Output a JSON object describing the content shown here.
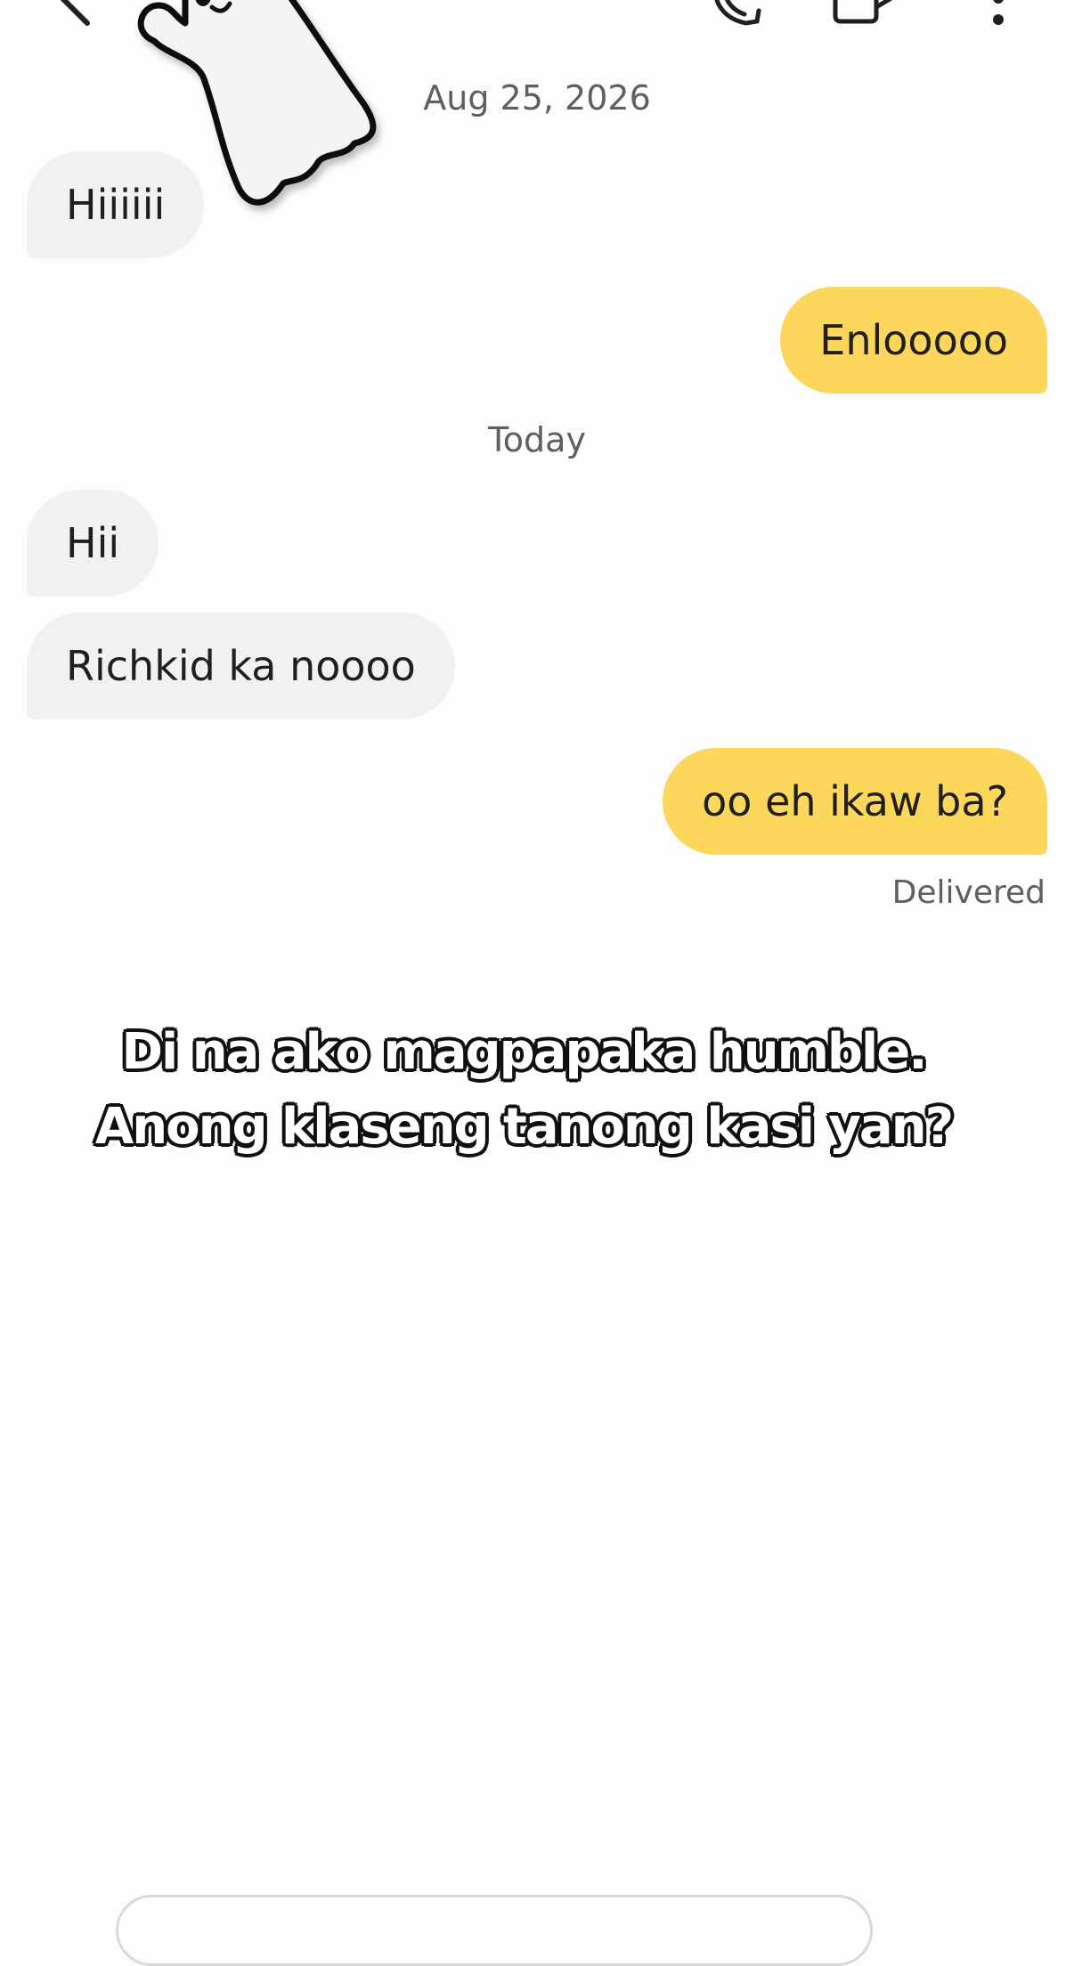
{
  "header": {
    "back_icon": "back-arrow-icon",
    "call_icon": "phone-icon",
    "video_icon": "video-call-icon",
    "more_icon": "more-vertical-icon"
  },
  "sticker": {
    "description_icon": "ghost-sticker-icon"
  },
  "conversation": {
    "date_separators": [
      "Aug 25, 2026",
      "Today"
    ],
    "messages": [
      {
        "direction": "incoming",
        "text": "Hiiiiii"
      },
      {
        "direction": "outgoing",
        "text": "Enlooooo"
      },
      {
        "direction": "incoming",
        "text": "Hii"
      },
      {
        "direction": "incoming",
        "text": "Richkid ka noooo"
      },
      {
        "direction": "outgoing",
        "text": "oo eh ikaw ba?"
      }
    ],
    "status": "Delivered"
  },
  "caption": {
    "line1": "Di na ako magpapaka humble.",
    "line2": "Anong klaseng tanong kasi yan?"
  },
  "colors": {
    "incoming_bubble": "#f1f1f1",
    "outgoing_bubble": "#fcd75b",
    "background": "#fdfdfd"
  }
}
